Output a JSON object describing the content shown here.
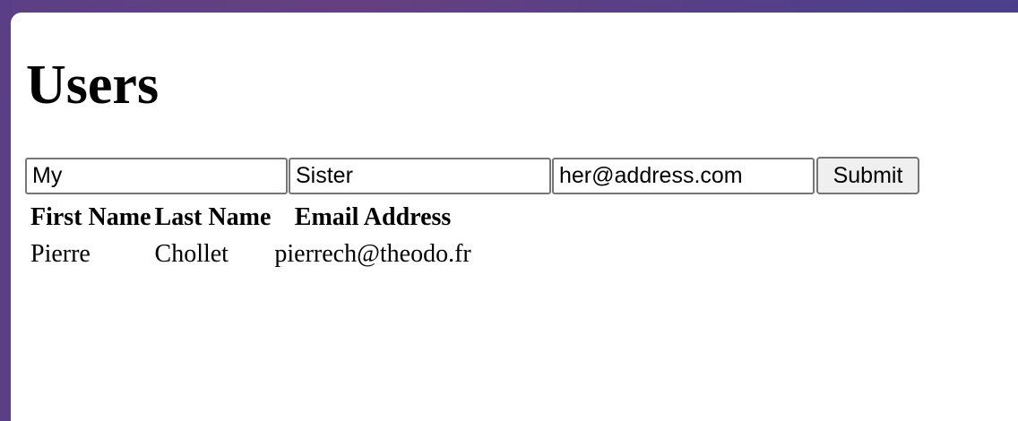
{
  "page": {
    "title": "Users"
  },
  "form": {
    "first_name_value": "My",
    "last_name_value": "Sister",
    "email_value": "her@address.com",
    "submit_label": "Submit"
  },
  "table": {
    "headers": [
      "First Name",
      "Last Name",
      "Email Address"
    ],
    "rows": [
      [
        "Pierre",
        "Chollet",
        "pierrech@theodo.fr"
      ]
    ]
  }
}
